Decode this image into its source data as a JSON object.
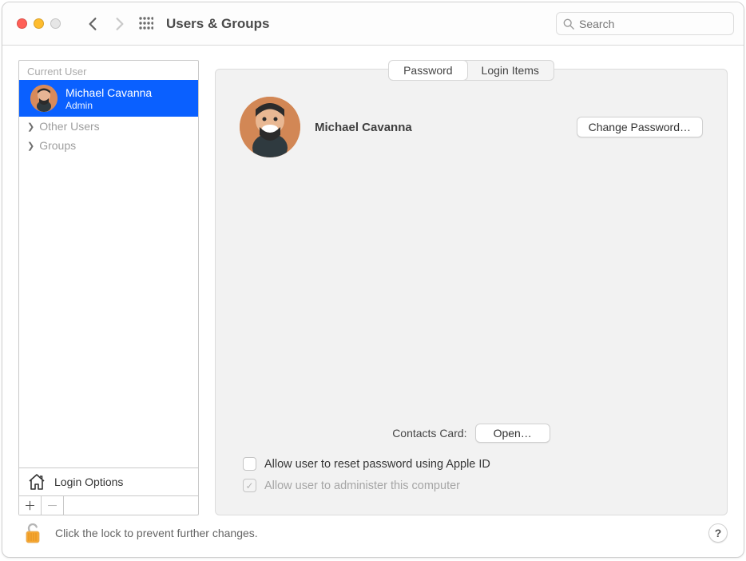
{
  "toolbar": {
    "title": "Users & Groups",
    "search_placeholder": "Search"
  },
  "sidebar": {
    "current_user_header": "Current User",
    "current_user": {
      "name": "Michael Cavanna",
      "role": "Admin"
    },
    "other_users_label": "Other Users",
    "groups_label": "Groups",
    "login_options_label": "Login Options"
  },
  "main": {
    "tabs": {
      "password": "Password",
      "login_items": "Login Items"
    },
    "display_name": "Michael Cavanna",
    "change_password_button": "Change Password…",
    "contacts_card_label": "Contacts Card:",
    "open_button": "Open…",
    "reset_apple_id_label": "Allow user to reset password using Apple ID",
    "administer_label": "Allow user to administer this computer"
  },
  "footer": {
    "lock_text": "Click the lock to prevent further changes.",
    "help_label": "?"
  }
}
